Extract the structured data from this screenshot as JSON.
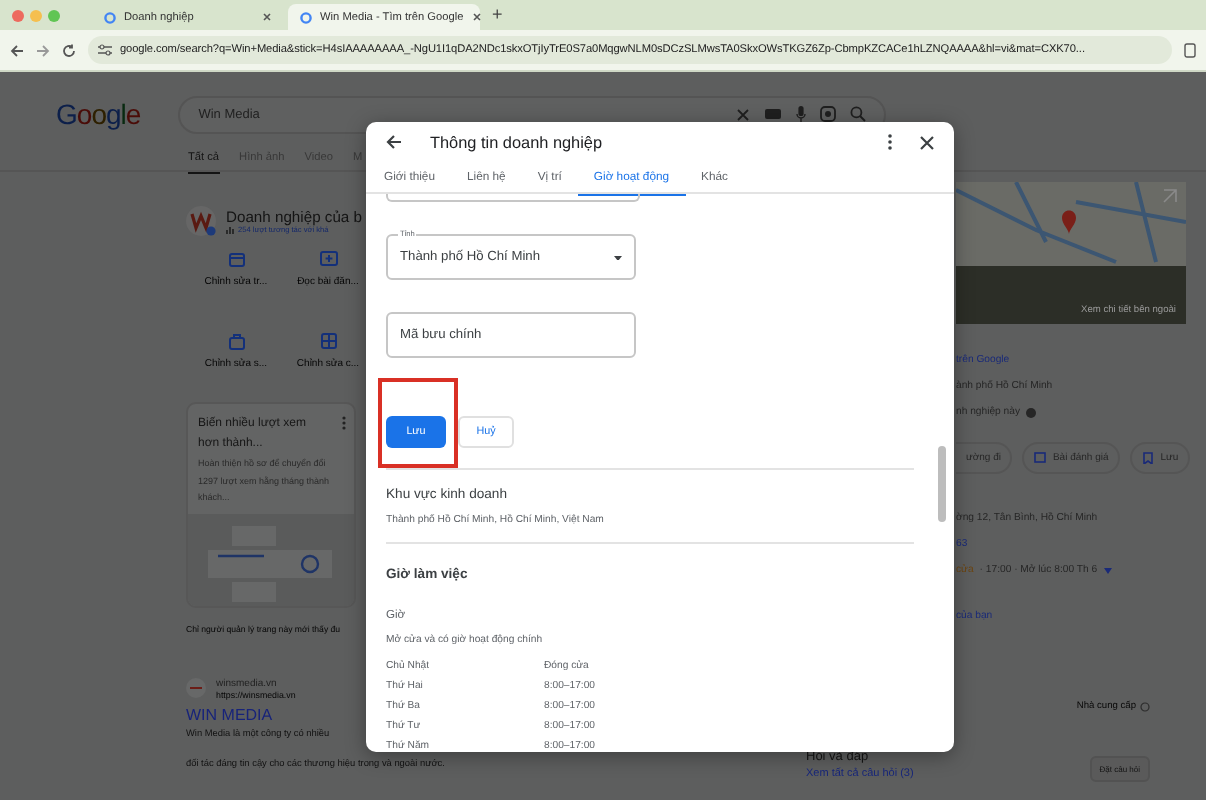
{
  "browser": {
    "tabs": [
      {
        "title": "Doanh nghiệp",
        "selected": false
      },
      {
        "title": "Win Media - Tìm trên Google",
        "selected": true
      }
    ],
    "new_tab": "+",
    "url": "google.com/search?q=Win+Media&stick=H4sIAAAAAAAA_-NgU1I1qDA2NDc1skxOTjIyTrE0S7a0MqgwNLM0sDCzSLMwsTA0SkxOWsTKGZ6Zp-CbmpKZCACe1hLZNQAAAA&hl=vi&mat=CXK70..."
  },
  "search": {
    "logo": "Google",
    "query": "Win Media",
    "tabs": [
      {
        "label": "Tất cả",
        "selected": true
      },
      {
        "label": "Hình ảnh",
        "selected": false
      },
      {
        "label": "Video",
        "selected": false
      },
      {
        "label": "M",
        "selected": false
      }
    ]
  },
  "business": {
    "name": "Doanh nghiệp của b",
    "interactions": "254 lượt tương tác với khá",
    "actions": [
      {
        "kind": "storefront",
        "label": "Chỉnh sửa tr..."
      },
      {
        "kind": "post",
        "label": "Đọc bài đăn..."
      },
      {
        "kind": "bag",
        "label": "Chỉnh sửa s..."
      },
      {
        "kind": "grid",
        "label": "Chỉnh sửa c..."
      }
    ],
    "promo": {
      "title": "Biến nhiều lượt xem hơn thành...",
      "text": "Hoàn thiện hồ sơ để chuyển đổi 1297 lượt xem hằng tháng thành khách..."
    },
    "notice": "Chỉ người quản lý trang này mới thấy đu"
  },
  "result": {
    "site": "winsmedia.vn",
    "url": "https://winsmedia.vn",
    "title": "WIN MEDIA",
    "snippet": [
      "Win Media là một công ty có nhiều",
      "đối tác đáng tin cậy cho các thương hiệu trong và ngoài nước."
    ]
  },
  "panel": {
    "map_label": "Xem chi tiết bên ngoài",
    "lines": [
      {
        "kind": "link",
        "text": "trên Google"
      },
      {
        "kind": "text",
        "text": "ành phố Hồ Chí Minh"
      },
      {
        "kind": "info",
        "text": "nh nghiệp này"
      }
    ],
    "chips": [
      {
        "kind": "directions",
        "label": "ường đi"
      },
      {
        "kind": "review",
        "label": "Bài đánh giá"
      },
      {
        "kind": "save",
        "label": "Lưu"
      }
    ],
    "address": "ờng 12, Tân Bình, Hồ Chí Minh",
    "phone": "63",
    "hours": {
      "status": "cửa",
      "detail": "· 17:00 · Mở lúc 8:00 Th 6"
    },
    "suggest": "của bạn",
    "provider": "Nhà cung cấp",
    "qa": {
      "title": "Hỏi và đáp",
      "link": "Xem tất cả câu hỏi (3)",
      "ask": "Đặt câu hỏi"
    }
  },
  "dialog": {
    "title": "Thông tin doanh nghiệp",
    "tabs": [
      {
        "label": "Giới thiệu",
        "selected": false
      },
      {
        "label": "Liên hệ",
        "selected": false
      },
      {
        "label": "Vị trí",
        "selected": false
      },
      {
        "label": "Giờ hoạt động",
        "selected": true
      },
      {
        "label": "Khác",
        "selected": false
      }
    ],
    "province": {
      "label": "Tỉnh",
      "value": "Thành phố Hồ Chí Minh"
    },
    "postal": {
      "placeholder": "Mã bưu chính"
    },
    "buttons": [
      {
        "kind": "primary",
        "label": "Lưu",
        "highlighted": true
      },
      {
        "kind": "secondary",
        "label": "Huỷ",
        "highlighted": false
      }
    ],
    "area": {
      "title": "Khu vực kinh doanh",
      "value": "Thành phố Hồ Chí Minh, Hồ Chí Minh, Việt Nam"
    },
    "hours": {
      "title": "Giờ làm việc",
      "subtitle": "Giờ",
      "note": "Mở cửa và có giờ hoạt động chính",
      "days": [
        {
          "day": "Chủ Nhật",
          "time": "Đóng cửa"
        },
        {
          "day": "Thứ Hai",
          "time": "8:00–17:00"
        },
        {
          "day": "Thứ Ba",
          "time": "8:00–17:00"
        },
        {
          "day": "Thứ Tư",
          "time": "8:00–17:00"
        },
        {
          "day": "Thứ Năm",
          "time": "8:00–17:00"
        }
      ]
    }
  }
}
